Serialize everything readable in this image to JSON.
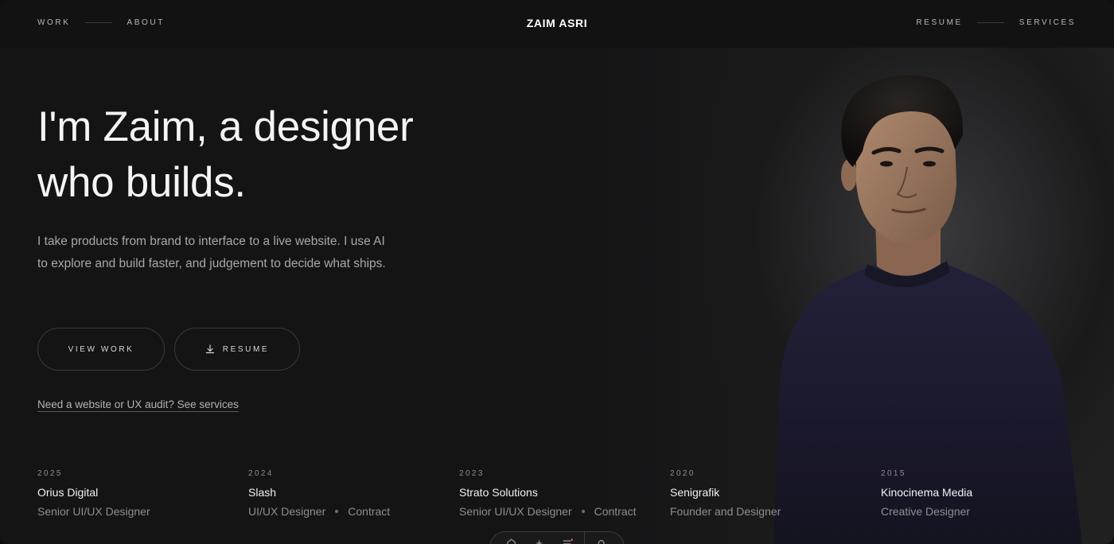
{
  "header": {
    "brand": "ZAIM ASRI",
    "nav_left": [
      "WORK",
      "ABOUT"
    ],
    "nav_right": [
      "RESUME",
      "SERVICES"
    ]
  },
  "hero": {
    "headline_line1": "I'm Zaim, a designer",
    "headline_line2": "who builds.",
    "intro": "I take products from brand to interface to a live website. I use AI to explore and build faster, and judgement to decide what ships.",
    "btn_view_work": "VIEW WORK",
    "btn_resume": "RESUME",
    "services_link": "Need a website or UX audit? See services"
  },
  "timeline": [
    {
      "year": "2025",
      "company": "Orius Digital",
      "role": "Senior UI/UX Designer",
      "type": ""
    },
    {
      "year": "2024",
      "company": "Slash",
      "role": "UI/UX Designer",
      "type": "Contract"
    },
    {
      "year": "2023",
      "company": "Strato Solutions",
      "role": "Senior UI/UX Designer",
      "type": "Contract"
    },
    {
      "year": "2020",
      "company": "Senigrafik",
      "role": "Founder and Designer",
      "type": ""
    },
    {
      "year": "2015",
      "company": "Kinocinema Media",
      "role": "Creative Designer",
      "type": ""
    }
  ],
  "colors": {
    "background": "#141415",
    "text_primary": "#f4f4f4",
    "text_muted": "#a8a8aa",
    "sweater": "#1d1c2a"
  },
  "icons": {
    "resume_button": "download-icon",
    "dock": [
      "home-icon",
      "sparkle-icon",
      "list-icon",
      "settings-icon"
    ]
  }
}
